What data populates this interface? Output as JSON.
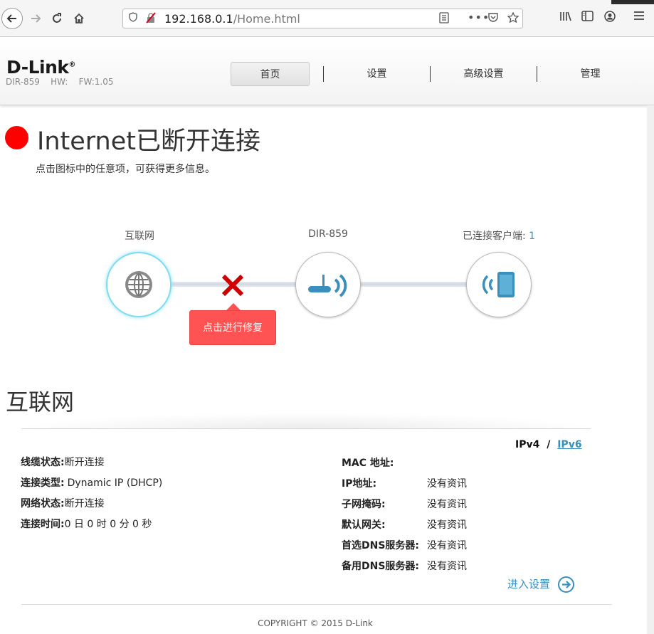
{
  "browser": {
    "url_host": "192.168.0.1",
    "url_path": "/Home.html"
  },
  "header": {
    "logo": "D-Link",
    "model": "DIR-859",
    "hw_label": "HW:",
    "fw_label": "FW:1.05",
    "tabs": [
      {
        "label": "首页",
        "active": true
      },
      {
        "label": "设置",
        "active": false
      },
      {
        "label": "高级设置",
        "active": false
      },
      {
        "label": "管理",
        "active": false
      }
    ]
  },
  "status": {
    "title": "Internet已断开连接",
    "subtitle": "点击图标中的任意项，可获得更多信息。",
    "dot_color": "#ff0000"
  },
  "topology": {
    "internet_label": "互联网",
    "router_label": "DIR-859",
    "clients_label": "已连接客户端: ",
    "clients_count": "1",
    "repair_label": "点击进行修复"
  },
  "internet": {
    "section_title": "互联网",
    "ipv4": "IPv4",
    "slash": "/",
    "ipv6": "IPv6",
    "left": [
      {
        "key": "线缆状态:",
        "value": "断开连接"
      },
      {
        "key": "连接类型:",
        "value": "Dynamic IP (DHCP)"
      },
      {
        "key": "网络状态:",
        "value": "断开连接"
      },
      {
        "key": "连接时间:",
        "value": "0 日 0 时 0 分 0 秒"
      }
    ],
    "right": [
      {
        "key": "MAC 地址:",
        "value": ""
      },
      {
        "key": "IP地址:",
        "value": "没有资讯"
      },
      {
        "key": "子网掩码:",
        "value": "没有资讯"
      },
      {
        "key": "默认网关:",
        "value": "没有资讯"
      },
      {
        "key": "首选DNS服务器:",
        "value": "没有资讯"
      },
      {
        "key": "备用DNS服务器:",
        "value": "没有资讯"
      }
    ],
    "goto_settings": "进入设置"
  },
  "footer": {
    "copyright": "COPYRIGHT © 2015 D-Link"
  },
  "colors": {
    "accent": "#3a8fbd",
    "repair": "#ff5252",
    "error": "#cc0000"
  }
}
